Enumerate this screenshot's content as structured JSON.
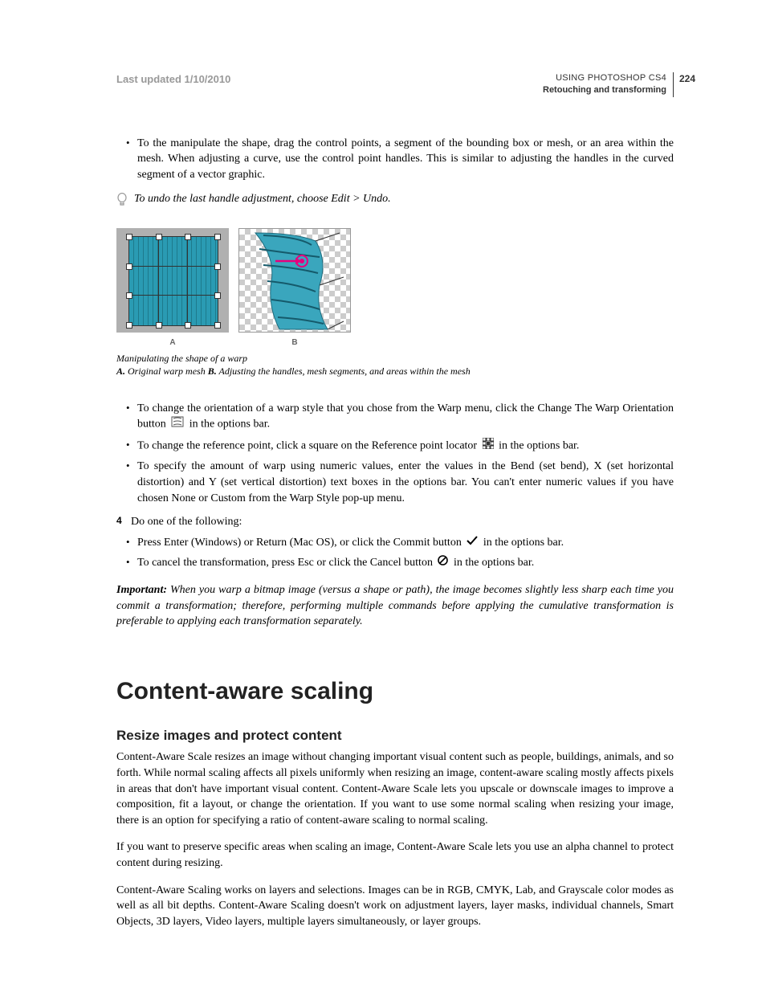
{
  "header": {
    "last_updated": "Last updated 1/10/2010",
    "doc_title": "USING PHOTOSHOP CS4",
    "chapter": "Retouching and transforming",
    "page_number": "224"
  },
  "bullets_top": [
    "To the manipulate the shape, drag the control points, a segment of the bounding box or mesh, or an area within the mesh. When adjusting a curve, use the control point handles. This is similar to adjusting the handles in the curved segment of a vector graphic."
  ],
  "tip": "To undo the last handle adjustment, choose Edit > Undo.",
  "figure": {
    "label_a": "A",
    "label_b": "B",
    "caption_title": "Manipulating the shape of a warp",
    "key_a": "A.",
    "desc_a": " Original warp mesh  ",
    "key_b": "B.",
    "desc_b": " Adjusting the handles, mesh segments, and areas within the mesh"
  },
  "bullets_mid": [
    {
      "pre": "To change the orientation of a warp style that you chose from the Warp menu, click the Change The Warp Orientation button ",
      "icon": "warp-orientation-icon",
      "post": " in the options bar."
    },
    {
      "pre": "To change the reference point, click a square on the Reference point locator ",
      "icon": "reference-point-icon",
      "post": " in the options bar."
    },
    {
      "pre": "To specify the amount of warp using numeric values, enter the values in the Bend (set bend), X (set horizontal distortion) and Y (set vertical distortion) text boxes in the options bar. You can't enter numeric values if you have chosen None or Custom from the Warp Style pop-up menu.",
      "icon": null,
      "post": ""
    }
  ],
  "step4": {
    "num": "4",
    "text": "Do one of the following:"
  },
  "bullets_step4": [
    {
      "pre": "Press Enter (Windows) or Return (Mac OS), or click the Commit button ",
      "icon": "commit-checkmark-icon",
      "post": " in the options bar."
    },
    {
      "pre": "To cancel the transformation, press Esc or click the Cancel button ",
      "icon": "cancel-prohibit-icon",
      "post": " in the options bar."
    }
  ],
  "important": {
    "label": "Important: ",
    "body": "When you warp a bitmap image (versus a shape or path), the image becomes slightly less sharp each time you commit a transformation; therefore, performing multiple commands before applying the cumulative transformation is preferable to applying each transformation separately."
  },
  "section_heading": "Content-aware scaling",
  "subsection_heading": "Resize images and protect content",
  "paragraphs": [
    "Content-Aware Scale resizes an image without changing important visual content such as people, buildings, animals, and so forth. While normal scaling affects all pixels uniformly when resizing an image, content-aware scaling mostly affects pixels in areas that don't have important visual content. Content-Aware Scale lets you upscale or downscale images to improve a composition, fit a layout, or change the orientation. If you want to use some normal scaling when resizing your image, there is an option for specifying a ratio of content-aware scaling to normal scaling.",
    "If you want to preserve specific areas when scaling an image, Content-Aware Scale lets you use an alpha channel to protect content during resizing.",
    "Content-Aware Scaling works on layers and selections. Images can be in RGB, CMYK, Lab, and Grayscale color modes as well as all bit depths. Content-Aware Scaling doesn't work on adjustment layers, layer masks, individual channels, Smart Objects, 3D layers, Video layers, multiple layers simultaneously, or layer groups."
  ]
}
